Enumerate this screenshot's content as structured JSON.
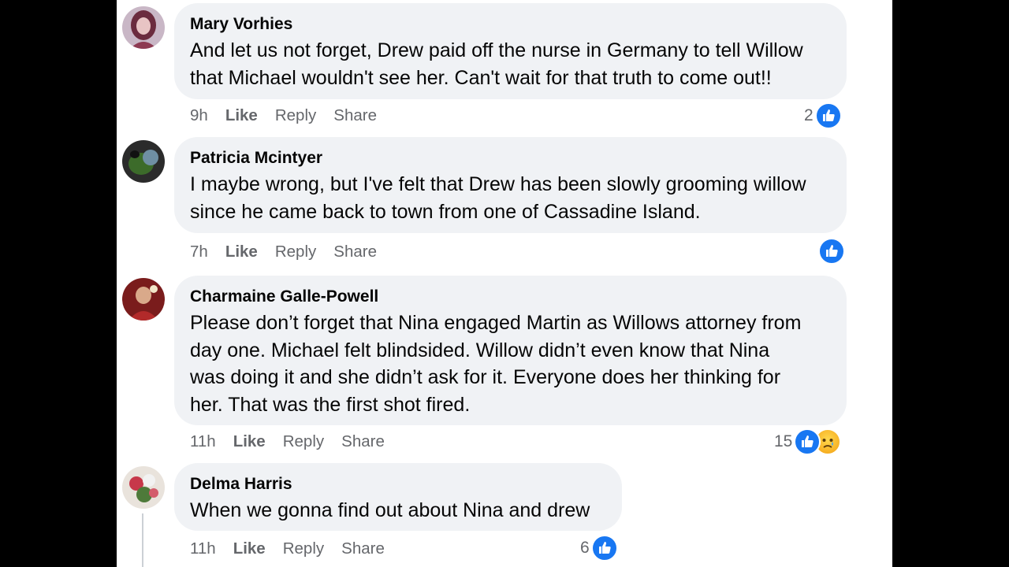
{
  "comments": [
    {
      "author": "Mary Vorhies",
      "text_lines": [
        "And let us not forget, Drew paid off the nurse in Germany to tell Willow",
        "that Michael wouldn't see her. Can't wait for that truth to come out!!"
      ],
      "time": "9h",
      "like_label": "Like",
      "reply_label": "Reply",
      "share_label": "Share",
      "reaction_count": "2",
      "reactions": [
        "like"
      ]
    },
    {
      "author": "Patricia Mcintyer",
      "text_lines": [
        "I maybe wrong, but I've felt that Drew has been slowly grooming willow",
        "since he came back to town from one of Cassadine Island."
      ],
      "time": "7h",
      "like_label": "Like",
      "reply_label": "Reply",
      "share_label": "Share",
      "reaction_count": "",
      "reactions": [
        "like"
      ]
    },
    {
      "author": "Charmaine Galle-Powell",
      "text_lines": [
        "Please don’t forget that Nina engaged Martin as Willows attorney from",
        "day one. Michael felt blindsided. Willow didn’t even know that Nina",
        "was doing it and she didn’t ask for it. Everyone does her thinking for",
        "her. That was the first shot fired."
      ],
      "time": "11h",
      "like_label": "Like",
      "reply_label": "Reply",
      "share_label": "Share",
      "reaction_count": "15",
      "reactions": [
        "like",
        "sad"
      ]
    },
    {
      "author": "Delma Harris",
      "text_lines": [
        "When we gonna find out about Nina and drew"
      ],
      "time": "11h",
      "like_label": "Like",
      "reply_label": "Reply",
      "share_label": "Share",
      "reaction_count": "6",
      "reactions": [
        "like"
      ]
    }
  ],
  "colors": {
    "bubble_bg": "#f0f2f5",
    "meta_text": "#65676b",
    "like_blue": "#1877f2"
  }
}
